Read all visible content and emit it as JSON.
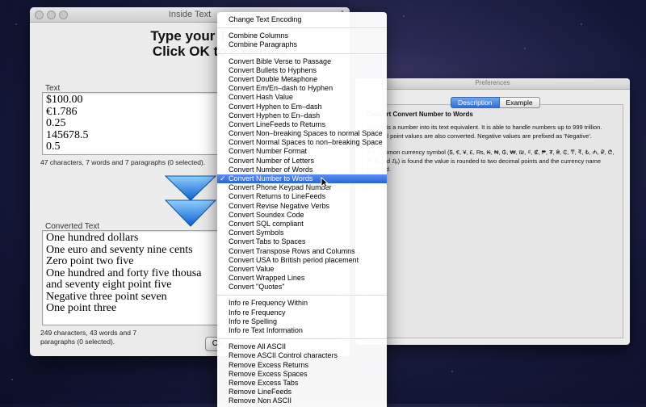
{
  "main_window": {
    "title": "Inside Text",
    "headline_line1": "Type your Text below",
    "headline_line2": "Click OK to Examine",
    "text_label": "Text",
    "input_lines": [
      "$100.00",
      "€1.786",
      "0.25",
      "145678.5",
      "0.5"
    ],
    "input_stats": "47 characters, 7 words and 7 paragraphs (0 selected).",
    "converted_label": "Converted Text",
    "output_lines": [
      "One hundred dollars",
      "One euro and seventy nine cents",
      "Zero point two five",
      "One hundred and forty five thousa",
      "and seventy eight point five",
      "Negative three point seven",
      "One point three"
    ],
    "output_stats_line1": "249 characters, 43 words and 7",
    "output_stats_line2": "paragraphs (0 selected).",
    "ok_label": "OK"
  },
  "preferences_window": {
    "title": "Preferences",
    "tabs": [
      {
        "label": "Description",
        "active": true
      },
      {
        "label": "Example",
        "active": false
      }
    ],
    "heading": "Convert Convert Number to Words",
    "paragraphs": [
      "Converts a number into its text equivalent. It is able to handle numbers up to 999 trillion. Decimal point values are also converted. Negative values are prefixed as 'Negative'.",
      "If a common currency symbol ($, €, ¥, £, ₨, ₭, ₦, ₲, ₩, ₪, ₫, ₡, ₱, ₮, ₴, ₵, ₸, ₹, ₺, ₼, ₽, ₾, ₿, ฿ and ₯) is found the value is rounded to two decimal points and the currency name included."
    ]
  },
  "menu": {
    "groups": [
      [
        "Change Text Encoding"
      ],
      [
        "Combine Columns",
        "Combine Paragraphs"
      ],
      [
        "Convert Bible Verse to Passage",
        "Convert Bullets to Hyphens",
        "Convert Double Metaphone",
        "Convert Em/En–dash to Hyphen",
        "Convert Hash Value",
        "Convert Hyphen to Em–dash",
        "Convert Hyphen to En–dash",
        "Convert LineFeeds to Returns",
        "Convert Non–breaking Spaces to normal Space",
        "Convert Normal Spaces to non–breaking Space",
        "Convert Number Format",
        "Convert Number of Letters",
        "Convert Number of Words",
        "Convert Number to Words",
        "Convert Phone Keypad Number",
        "Convert Returns to LineFeeds",
        "Convert Revise Negative Verbs",
        "Convert Soundex Code",
        "Convert SQL compliant",
        "Convert Symbols",
        "Convert Tabs to Spaces",
        "Convert Transpose Rows and Columns",
        "Convert USA to British period placement",
        "Convert Value",
        "Convert Wrapped Lines",
        "Convert \"Quotes\""
      ],
      [
        "Info re Frequency Within",
        "Info re Frequency",
        "Info re Spelling",
        "Info re Text Information"
      ],
      [
        "Remove All ASCII",
        "Remove ASCII Control characters",
        "Remove Excess Returns",
        "Remove Excess Spaces",
        "Remove Excess Tabs",
        "Remove LineFeeds",
        "Remove Non ASCII"
      ]
    ],
    "selected_item": "Convert Number to Words",
    "check_mark": "✓"
  },
  "colors": {
    "menu_highlight": "#2c63d9",
    "arrow_blue": "#1e7fe0"
  }
}
